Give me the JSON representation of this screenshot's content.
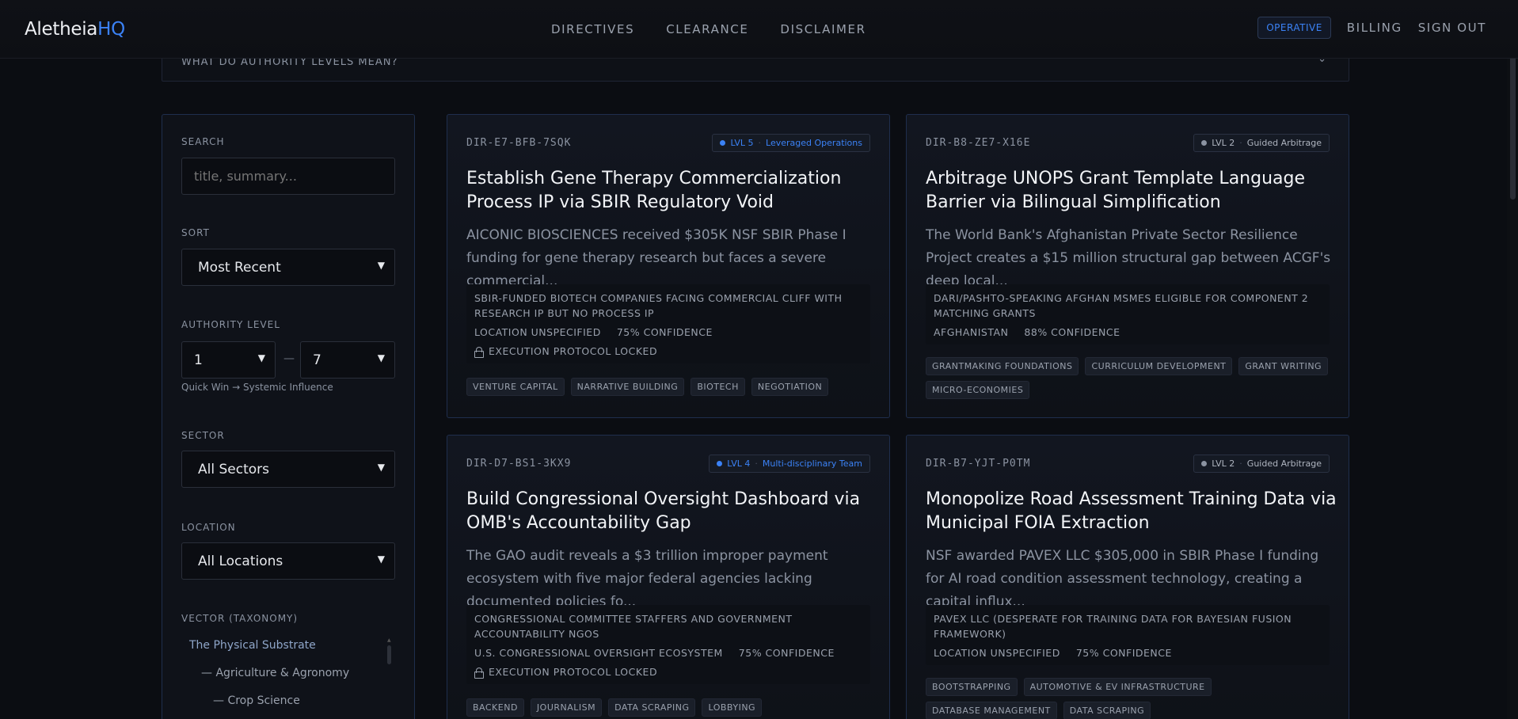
{
  "app": {
    "logo_main": "Aletheia",
    "logo_accent": "HQ",
    "accent_color": "#3b82f6"
  },
  "nav": {
    "links": [
      "DIRECTIVES",
      "CLEARANCE",
      "DISCLAIMER"
    ],
    "badge": "OPERATIVE",
    "billing": "BILLING",
    "sign_out": "SIGN OUT"
  },
  "accordion": {
    "label": "WHAT DO AUTHORITY LEVELS MEAN?",
    "icon": "chevron-down-icon"
  },
  "sidebar": {
    "search_label": "SEARCH",
    "search_placeholder": "title, summary...",
    "sort_label": "SORT",
    "sort_value": "Most Recent",
    "authority_label": "AUTHORITY LEVEL",
    "authority_min": "1",
    "authority_max": "7",
    "authority_dash": "—",
    "authority_hint": "Quick Win → Systemic Influence",
    "sector_label": "SECTOR",
    "sector_value": "All Sectors",
    "location_label": "LOCATION",
    "location_value": "All Locations",
    "vector_label": "VECTOR (TAXONOMY)",
    "taxonomy": [
      "The Physical Substrate",
      "— Agriculture & Agronomy",
      "— Crop Science"
    ]
  },
  "cards": [
    {
      "id": "DIR-E7-BFB-7SQK",
      "level": "LVL 5",
      "level_name": "Leveraged Operations",
      "level_color": "#3b82f6",
      "title": "Establish Gene Therapy Commercialization Process IP via SBIR Regulatory Void",
      "summary": "AICONIC BIOSCIENCES received $305K NSF SBIR Phase I funding for gene therapy research but faces a severe commercial...",
      "audience": "SBIR-FUNDED BIOTECH COMPANIES FACING COMMERCIAL CLIFF WITH RESEARCH IP BUT NO PROCESS IP",
      "location": "LOCATION UNSPECIFIED",
      "confidence": "75% CONFIDENCE",
      "locked": "EXECUTION PROTOCOL LOCKED",
      "tags": [
        "VENTURE CAPITAL",
        "NARRATIVE BUILDING",
        "BIOTECH",
        "NEGOTIATION"
      ]
    },
    {
      "id": "DIR-B8-ZE7-X16E",
      "level": "LVL 2",
      "level_name": "Guided Arbitrage",
      "level_color": "#8b93a1",
      "title": "Arbitrage UNOPS Grant Template Language Barrier via Bilingual Simplification",
      "summary": "The World Bank's Afghanistan Private Sector Resilience Project creates a $15 million structural gap between ACGF's deep local...",
      "audience": "DARI/PASHTO-SPEAKING AFGHAN MSMES ELIGIBLE FOR COMPONENT 2 MATCHING GRANTS",
      "location": "AFGHANISTAN",
      "confidence": "88% CONFIDENCE",
      "locked": "",
      "tags": [
        "GRANTMAKING FOUNDATIONS",
        "CURRICULUM DEVELOPMENT",
        "GRANT WRITING",
        "MICRO-ECONOMIES"
      ]
    },
    {
      "id": "DIR-D7-BS1-3KX9",
      "level": "LVL 4",
      "level_name": "Multi-disciplinary Team",
      "level_color": "#3b82f6",
      "title": "Build Congressional Oversight Dashboard via OMB's Accountability Gap",
      "summary": "The GAO audit reveals a $3 trillion improper payment ecosystem with five major federal agencies lacking documented policies fo...",
      "audience": "CONGRESSIONAL COMMITTEE STAFFERS AND GOVERNMENT ACCOUNTABILITY NGOS",
      "location": "U.S. CONGRESSIONAL OVERSIGHT ECOSYSTEM",
      "confidence": "75% CONFIDENCE",
      "locked": "EXECUTION PROTOCOL LOCKED",
      "tags": [
        "BACKEND",
        "JOURNALISM",
        "DATA SCRAPING",
        "LOBBYING"
      ]
    },
    {
      "id": "DIR-B7-YJT-P0TM",
      "level": "LVL 2",
      "level_name": "Guided Arbitrage",
      "level_color": "#8b93a1",
      "title": "Monopolize Road Assessment Training Data via Municipal FOIA Extraction",
      "summary": "NSF awarded PAVEX LLC $305,000 in SBIR Phase I funding for AI road condition assessment technology, creating a capital influx...",
      "audience": "PAVEX LLC (DESPERATE FOR TRAINING DATA FOR BAYESIAN FUSION FRAMEWORK)",
      "location": "LOCATION UNSPECIFIED",
      "confidence": "75% CONFIDENCE",
      "locked": "",
      "tags": [
        "BOOTSTRAPPING",
        "AUTOMOTIVE & EV INFRASTRUCTURE",
        "DATABASE MANAGEMENT",
        "DATA SCRAPING"
      ]
    }
  ]
}
